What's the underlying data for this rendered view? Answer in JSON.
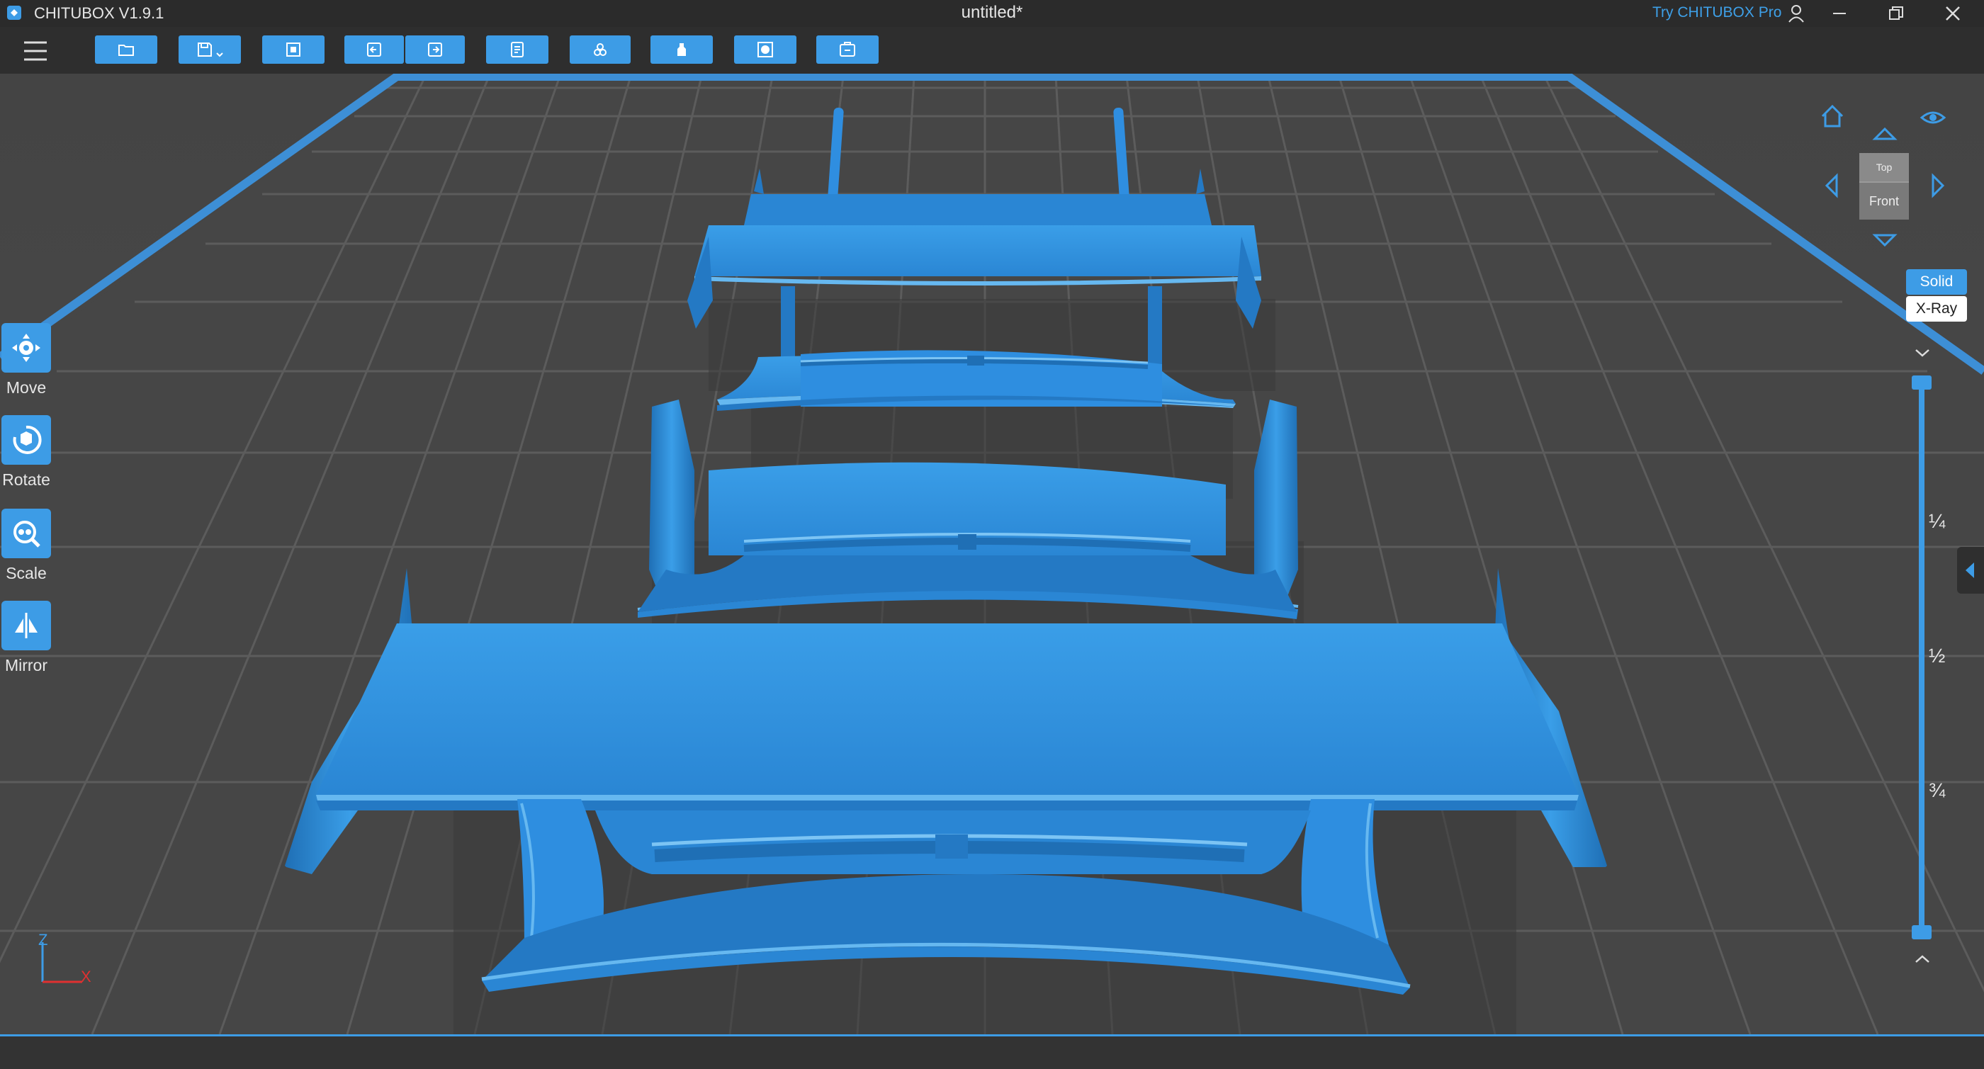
{
  "window": {
    "app_title": "CHITUBOX V1.9.1",
    "document_title": "untitled*",
    "try_pro_link": "Try CHITUBOX Pro"
  },
  "toolbar": {
    "buttons": [
      {
        "name": "open-file-button",
        "icon": "folder-icon"
      },
      {
        "name": "save-button",
        "icon": "save-icon"
      },
      {
        "name": "import-button",
        "icon": "import-icon"
      },
      {
        "name": "undo-button",
        "icon": "undo-icon"
      },
      {
        "name": "redo-button",
        "icon": "redo-icon"
      },
      {
        "name": "settings-button",
        "icon": "settings-icon"
      },
      {
        "name": "auto-layout-button",
        "icon": "layout-icon"
      },
      {
        "name": "supports-button",
        "icon": "supports-icon"
      },
      {
        "name": "hollow-button",
        "icon": "hollow-icon"
      },
      {
        "name": "slice-button",
        "icon": "slice-icon"
      }
    ]
  },
  "tools": [
    {
      "label": "Move"
    },
    {
      "label": "Rotate"
    },
    {
      "label": "Scale"
    },
    {
      "label": "Mirror"
    }
  ],
  "view_cube": {
    "top": "Top",
    "front": "Front"
  },
  "render_modes": {
    "solid": "Solid",
    "xray": "X-Ray",
    "active": "Solid"
  },
  "layer_slider": {
    "marks": [
      "¼",
      "½",
      "¾"
    ],
    "upper_fraction": 1.0,
    "lower_fraction": 0.0
  },
  "axes": {
    "z": "Z",
    "x": "X"
  },
  "colors": {
    "accent": "#3d9ce6",
    "model": "#2e8fe0",
    "floor": "#474747",
    "grid": "#5a5a5a"
  }
}
